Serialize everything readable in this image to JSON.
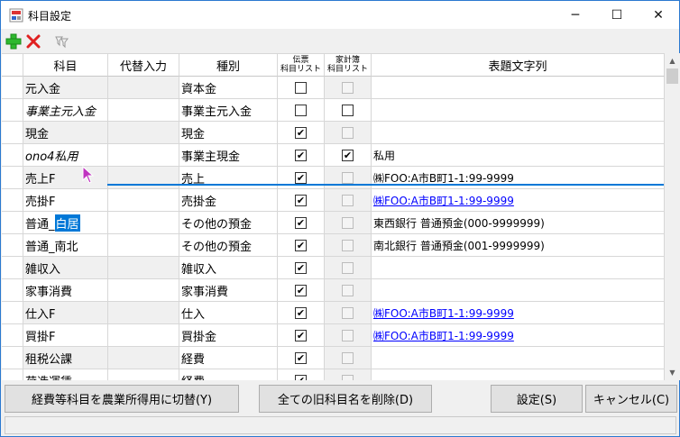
{
  "window": {
    "title": "科目設定",
    "minimize": "─",
    "maximize": "☐",
    "close": "✕"
  },
  "toolbar": {
    "add_icon": "plus-icon",
    "delete_icon": "delete-x-icon",
    "filter_icon": "filter-icon"
  },
  "grid": {
    "headers": {
      "kamoku": "科目",
      "alt": "代替入力",
      "type": "種別",
      "denpyo_1": "伝票",
      "denpyo_2": "科目リスト",
      "kakei_1": "家計簿",
      "kakei_2": "科目リスト",
      "title_str": "表題文字列"
    },
    "rows": [
      {
        "kamoku": "元入金",
        "alt": "",
        "type": "資本金",
        "denpyo": false,
        "kakei": false,
        "kakei_enabled": false,
        "title": "",
        "link": false,
        "italic": false
      },
      {
        "kamoku": "事業主元入金",
        "alt": "",
        "type": "事業主元入金",
        "denpyo": false,
        "kakei": false,
        "kakei_enabled": true,
        "title": "",
        "link": false,
        "italic": true
      },
      {
        "kamoku": "現金",
        "alt": "",
        "type": "現金",
        "denpyo": true,
        "kakei": false,
        "kakei_enabled": false,
        "title": "",
        "link": false,
        "italic": false
      },
      {
        "kamoku": "ono4私用",
        "alt": "",
        "type": "事業主現金",
        "denpyo": true,
        "kakei": true,
        "kakei_enabled": true,
        "title": "私用",
        "link": false,
        "italic": true
      },
      {
        "kamoku": "売上F",
        "alt": "",
        "type": "売上",
        "denpyo": true,
        "kakei": false,
        "kakei_enabled": false,
        "title": "㈱FOO:A市B町1-1:99-9999",
        "link": false,
        "italic": false
      },
      {
        "kamoku": "売掛F",
        "alt": "",
        "type": "売掛金",
        "denpyo": true,
        "kakei": false,
        "kakei_enabled": false,
        "title": "㈱FOO:A市B町1-1:99-9999",
        "link": true,
        "italic": false
      },
      {
        "kamoku": "普通_",
        "kamoku_sel": "白居",
        "alt": "",
        "type": "その他の預金",
        "denpyo": true,
        "kakei": false,
        "kakei_enabled": false,
        "title": "東西銀行 普通預金(000-9999999)",
        "link": false,
        "italic": false
      },
      {
        "kamoku": "普通_南北",
        "alt": "",
        "type": "その他の預金",
        "denpyo": true,
        "kakei": false,
        "kakei_enabled": false,
        "title": "南北銀行 普通預金(001-9999999)",
        "link": false,
        "italic": false
      },
      {
        "kamoku": "雑収入",
        "alt": "",
        "type": "雑収入",
        "denpyo": true,
        "kakei": false,
        "kakei_enabled": false,
        "title": "",
        "link": false,
        "italic": false
      },
      {
        "kamoku": "家事消費",
        "alt": "",
        "type": "家事消費",
        "denpyo": true,
        "kakei": false,
        "kakei_enabled": false,
        "title": "",
        "link": false,
        "italic": false
      },
      {
        "kamoku": "仕入F",
        "alt": "",
        "type": "仕入",
        "denpyo": true,
        "kakei": false,
        "kakei_enabled": false,
        "title": "㈱FOO:A市B町1-1:99-9999",
        "link": true,
        "italic": false
      },
      {
        "kamoku": "買掛F",
        "alt": "",
        "type": "買掛金",
        "denpyo": true,
        "kakei": false,
        "kakei_enabled": false,
        "title": "㈱FOO:A市B町1-1:99-9999",
        "link": true,
        "italic": false
      },
      {
        "kamoku": "租税公課",
        "alt": "",
        "type": "経費",
        "denpyo": true,
        "kakei": false,
        "kakei_enabled": false,
        "title": "",
        "link": false,
        "italic": false
      },
      {
        "kamoku": "荷造運賃",
        "alt": "",
        "type": "経費",
        "denpyo": true,
        "kakei": false,
        "kakei_enabled": false,
        "title": "",
        "link": false,
        "italic": false
      }
    ]
  },
  "buttons": {
    "switch": "経費等科目を農業所得用に切替(Y)",
    "delete_old": "全ての旧科目名を削除(D)",
    "settings": "設定(S)",
    "cancel": "キャンセル(C)"
  },
  "colors": {
    "accent": "#0078d7",
    "link": "#0000ff",
    "add": "#2eb82e",
    "delete": "#e02020"
  }
}
